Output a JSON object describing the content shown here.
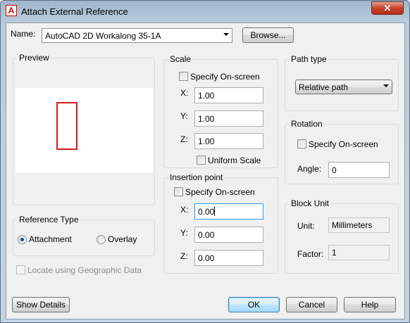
{
  "window": {
    "title": "Attach External Reference",
    "close_glyph": "✕",
    "app_icon_letter": "A"
  },
  "name_row": {
    "label": "Name:",
    "value": "AutoCAD 2D Workalong 35-1A",
    "browse_label": "Browse..."
  },
  "preview": {
    "title": "Preview",
    "accent_color": "#d21b1b"
  },
  "scale": {
    "title": "Scale",
    "specify_label": "Specify On-screen",
    "x_label": "X:",
    "x_value": "1.00",
    "y_label": "Y:",
    "y_value": "1.00",
    "z_label": "Z:",
    "z_value": "1.00",
    "uniform_label": "Uniform Scale"
  },
  "insertion": {
    "title": "Insertion point",
    "specify_label": "Specify On-screen",
    "x_label": "X:",
    "x_value": "0.00",
    "y_label": "Y:",
    "y_value": "0.00",
    "z_label": "Z:",
    "z_value": "0.00"
  },
  "path_type": {
    "title": "Path type",
    "selected": "Relative path"
  },
  "rotation": {
    "title": "Rotation",
    "specify_label": "Specify On-screen",
    "angle_label": "Angle:",
    "angle_value": "0"
  },
  "block_unit": {
    "title": "Block Unit",
    "unit_label": "Unit:",
    "unit_value": "Millimeters",
    "factor_label": "Factor:",
    "factor_value": "1"
  },
  "reference_type": {
    "title": "Reference Type",
    "attachment_label": "Attachment",
    "overlay_label": "Overlay",
    "selected": "Attachment"
  },
  "geo": {
    "label": "Locate using Geographic Data"
  },
  "footer": {
    "show_details": "Show Details",
    "ok": "OK",
    "cancel": "Cancel",
    "help": "Help"
  }
}
